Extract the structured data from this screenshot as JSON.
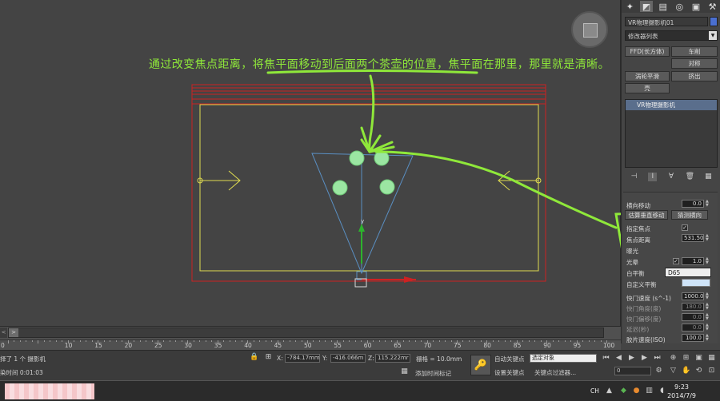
{
  "viewport": {
    "annotation": "通过改变焦点距离，将焦平面移动到后面两个茶壶的位置，焦平面在那里，那里就是清晰。",
    "axis_y_label": "y",
    "colors": {
      "camera_cone": "#5a8fc2",
      "frame": "#e0dc50",
      "safe_frame": "#cc2222",
      "teapot": "#9be6a2",
      "annotation": "#8fe83a"
    }
  },
  "panel": {
    "tabs": [
      "create-icon",
      "modify-icon",
      "hierarchy-icon",
      "motion-icon",
      "display-icon",
      "utilities-icon"
    ],
    "object_name": "VR物理摄影机01",
    "modifier_list": "修改器列表",
    "buttons": [
      "FFD(长方体)",
      "车削",
      "对称",
      "涡轮平滑",
      "挤出",
      "壳"
    ],
    "stack_item": "VR物理摄影机",
    "params": {
      "row0_label": "横向移动",
      "row0_value": "0.0",
      "guess_vert_btn": "估算垂直移动",
      "guess_horiz_btn": "猜测横向",
      "specify_focus": "指定焦点",
      "focus_distance_label": "焦点距离",
      "focus_distance_value": "531.50",
      "exposure": "曝光",
      "vignette_label": "光晕",
      "vignette_value": "1.0",
      "white_balance_label": "白平衡",
      "white_balance_value": "D65",
      "custom_balance_label": "自定义平衡",
      "shutter_speed_label": "快门速度 (s^-1)",
      "shutter_speed_value": "1000.0",
      "shutter_angle_label": "快门角度(度)",
      "shutter_angle_value": "180.0",
      "shutter_offset_label": "快门偏移(度)",
      "shutter_offset_value": "0.0",
      "latency_label": "延迟(秒)",
      "latency_value": "0.0",
      "iso_label": "胶片速度(ISO)",
      "iso_value": "100.0"
    }
  },
  "timeline": {
    "slider": "0 / 100",
    "ticks": [
      "10",
      "15",
      "20",
      "25",
      "30",
      "35",
      "40",
      "45",
      "50",
      "55",
      "60",
      "65",
      "70",
      "75",
      "80",
      "85",
      "90",
      "95",
      "100"
    ],
    "frame_edge": "0"
  },
  "status": {
    "selection": "择了 1 个 摄影机",
    "render_time": "染时间  0:01:03",
    "x_label": "X:",
    "x_value": "-784.17mm",
    "y_label": "Y:",
    "y_value": "-416.066m",
    "z_label": "Z:",
    "z_value": "115.222mr",
    "grid": "栅格 = 10.0mm",
    "add_time_tag": "添加时间标记",
    "auto_key": "自动关键点",
    "auto_key_value": "选定对象",
    "set_key": "设置关键点",
    "key_filter": "关键点过滤器...",
    "frame_value": "0"
  },
  "taskbar": {
    "lang": "CH",
    "time": "9:23",
    "date": "2014/7/9"
  }
}
